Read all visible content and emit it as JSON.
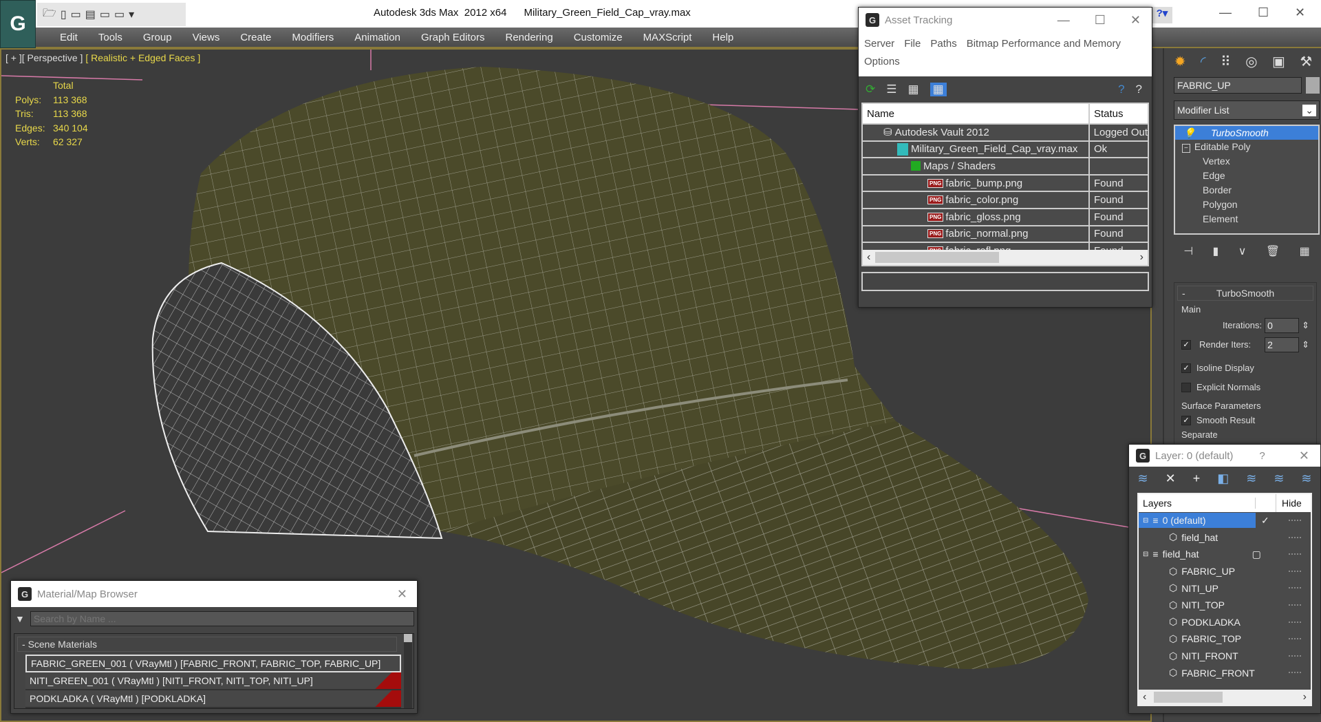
{
  "app": {
    "title": "Autodesk 3ds Max  2012 x64",
    "file": "Military_Green_Field_Cap_vray.max",
    "logo": "G"
  },
  "menu": [
    "Edit",
    "Tools",
    "Group",
    "Views",
    "Create",
    "Modifiers",
    "Animation",
    "Graph Editors",
    "Rendering",
    "Customize",
    "MAXScript",
    "Help"
  ],
  "viewport": {
    "label_plus": "[ + ]",
    "label_view": "[ Perspective ]",
    "label_shading": "[ Realistic + Edged Faces ]",
    "stats": {
      "header": "Total",
      "rows": [
        {
          "k": "Polys:",
          "v": "113 368"
        },
        {
          "k": "Tris:",
          "v": "113 368"
        },
        {
          "k": "Edges:",
          "v": "340 104"
        },
        {
          "k": "Verts:",
          "v": "62 327"
        }
      ]
    }
  },
  "asset_tracking": {
    "title": "Asset Tracking",
    "menu": [
      "Server",
      "File",
      "Paths",
      "Bitmap Performance and Memory",
      "Options"
    ],
    "columns": [
      "Name",
      "Status"
    ],
    "rows": [
      {
        "name": "Autodesk Vault 2012",
        "status": "Logged Out",
        "icon": "vault"
      },
      {
        "name": "Military_Green_Field_Cap_vray.max",
        "status": "Ok",
        "icon": "max"
      },
      {
        "name": "Maps / Shaders",
        "status": "",
        "icon": "maps"
      },
      {
        "name": "fabric_bump.png",
        "status": "Found",
        "icon": "png"
      },
      {
        "name": "fabric_color.png",
        "status": "Found",
        "icon": "png"
      },
      {
        "name": "fabric_gloss.png",
        "status": "Found",
        "icon": "png"
      },
      {
        "name": "fabric_normal.png",
        "status": "Found",
        "icon": "png"
      },
      {
        "name": "fabric_refl.png",
        "status": "Found",
        "icon": "png"
      }
    ],
    "png_badge": "PNG"
  },
  "command_panel": {
    "object_name": "FABRIC_UP",
    "modifier_list": "Modifier List",
    "stack": [
      {
        "label": "TurboSmooth",
        "selected": true
      },
      {
        "label": "Editable Poly"
      },
      {
        "label": "Vertex"
      },
      {
        "label": "Edge"
      },
      {
        "label": "Border"
      },
      {
        "label": "Polygon"
      },
      {
        "label": "Element"
      }
    ],
    "rollout": {
      "title": "TurboSmooth",
      "minus": "-",
      "main": "Main",
      "iterations_label": "Iterations:",
      "iterations": "0",
      "render_iters_label": "Render Iters:",
      "render_iters": "2",
      "render_iters_checked": true,
      "isoline": "Isoline Display",
      "isoline_checked": true,
      "explicit": "Explicit Normals",
      "explicit_checked": false,
      "surface": "Surface Parameters",
      "smooth_result": "Smooth Result",
      "smooth_checked": true,
      "separate": "Separate"
    }
  },
  "layer_dialog": {
    "title": "Layer: 0 (default)",
    "help": "?",
    "columns": [
      "Layers",
      "Hide"
    ],
    "rows": [
      {
        "label": "0 (default)",
        "level": 0,
        "selected": true,
        "type": "layer"
      },
      {
        "label": "field_hat",
        "level": 1,
        "type": "object"
      },
      {
        "label": "field_hat",
        "level": 0,
        "type": "layer"
      },
      {
        "label": "FABRIC_UP",
        "level": 1,
        "type": "object"
      },
      {
        "label": "NITI_UP",
        "level": 1,
        "type": "object"
      },
      {
        "label": "NITI_TOP",
        "level": 1,
        "type": "object"
      },
      {
        "label": "PODKLADKA",
        "level": 1,
        "type": "object"
      },
      {
        "label": "FABRIC_TOP",
        "level": 1,
        "type": "object"
      },
      {
        "label": "NITI_FRONT",
        "level": 1,
        "type": "object"
      },
      {
        "label": "FABRIC_FRONT",
        "level": 1,
        "type": "object"
      }
    ]
  },
  "material_browser": {
    "title": "Material/Map Browser",
    "search_placeholder": "Search by Name ...",
    "group": "Scene Materials",
    "group_toggle": "-",
    "items": [
      "FABRIC_GREEN_001  ( VRayMtl )  [FABRIC_FRONT, FABRIC_TOP, FABRIC_UP]",
      "NITI_GREEN_001  ( VRayMtl )  [NITI_FRONT, NITI_TOP, NITI_UP]",
      "PODKLADKA  ( VRayMtl )  [PODKLADKA]"
    ]
  },
  "colors": {
    "accent": "#3c7fd8",
    "stats": "#e8d84a",
    "hat": "#4b4a2a",
    "frame": "#8a7a3a"
  }
}
